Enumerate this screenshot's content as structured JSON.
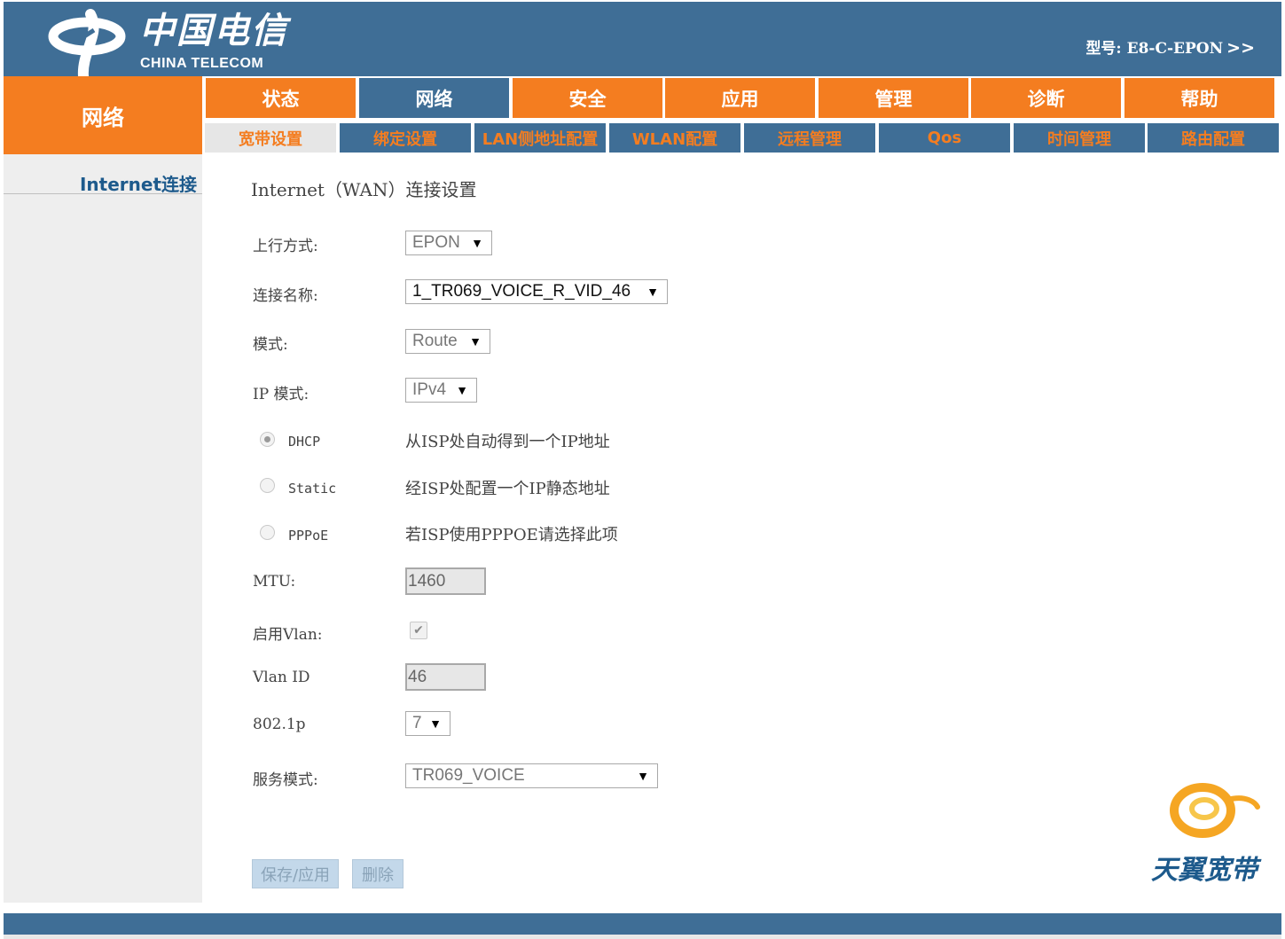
{
  "header": {
    "brand_cn": "中国电信",
    "brand_en": "CHINA TELECOM",
    "model_label": "型号: E8-C-EPON",
    "model_arrow": ">>"
  },
  "side_title": "网络",
  "main_tabs": [
    "状态",
    "网络",
    "安全",
    "应用",
    "管理",
    "诊断",
    "帮助"
  ],
  "main_active": "网络",
  "sub_tabs": [
    "宽带设置",
    "绑定设置",
    "LAN侧地址配置",
    "WLAN配置",
    "远程管理",
    "Qos",
    "时间管理",
    "路由配置"
  ],
  "sub_active": "宽带设置",
  "sidebar": {
    "item": "Internet连接"
  },
  "form": {
    "title": "Internet（WAN）连接设置",
    "uplink": {
      "label": "上行方式:",
      "value": "EPON"
    },
    "conn_name": {
      "label": "连接名称:",
      "value": "1_TR069_VOICE_R_VID_46"
    },
    "mode": {
      "label": "模式:",
      "value": "Route"
    },
    "ip_mode": {
      "label": "IP 模式:",
      "value": "IPv4"
    },
    "radios": [
      {
        "label": "DHCP",
        "desc": "从ISP处自动得到一个IP地址",
        "checked": true
      },
      {
        "label": "Static",
        "desc": "经ISP处配置一个IP静态地址",
        "checked": false
      },
      {
        "label": "PPPoE",
        "desc": "若ISP使用PPPOE请选择此项",
        "checked": false
      }
    ],
    "mtu": {
      "label": "MTU:",
      "value": "1460"
    },
    "vlan_enable": {
      "label": "启用Vlan:",
      "checked": true,
      "mark": "✔"
    },
    "vlan_id": {
      "label": "Vlan ID",
      "value": "46"
    },
    "dot1p": {
      "label": "802.1p",
      "value": "7"
    },
    "service_mode": {
      "label": "服务模式:",
      "value": "TR069_VOICE"
    },
    "save_label": "保存/应用",
    "delete_label": "删除"
  },
  "brand_logo_text": "天翼宽带",
  "icons": {
    "select_arrow": "▼"
  },
  "colors": {
    "blue": "#3f6e96",
    "orange": "#f47d20",
    "link": "#1d5a8c"
  }
}
